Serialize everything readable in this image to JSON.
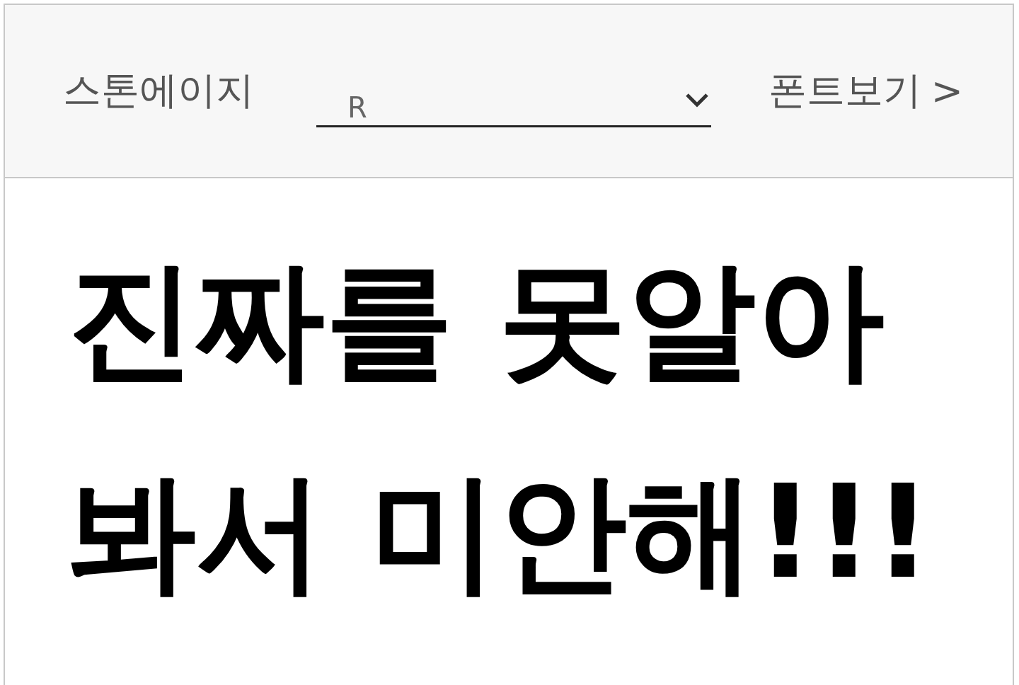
{
  "font_name": "스톤에이지",
  "weight_select": {
    "value": "R"
  },
  "view_link": {
    "label": "폰트보기",
    "arrow": ">"
  },
  "preview_text": "진짜를 못알아 봐서 미안해!!!"
}
